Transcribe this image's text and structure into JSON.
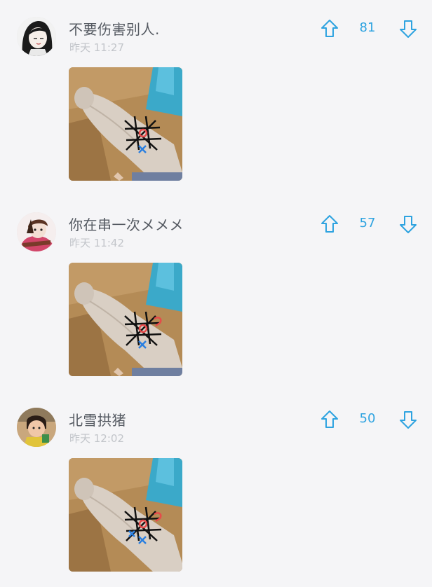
{
  "comments": [
    {
      "username": "不要伤害别人.",
      "timestamp": "昨天 11:27",
      "votes": "81",
      "avatar_icon": "anime-girl-avatar",
      "image_icon": "arm-tic-tac-toe-photo"
    },
    {
      "username": "你在串一次メメメ",
      "timestamp": "昨天 11:42",
      "votes": "57",
      "avatar_icon": "anime-character-avatar",
      "image_icon": "arm-tic-tac-toe-photo"
    },
    {
      "username": "北雪拱猪",
      "timestamp": "昨天 12:02",
      "votes": "50",
      "avatar_icon": "child-photo-avatar",
      "image_icon": "arm-tic-tac-toe-photo"
    }
  ],
  "colors": {
    "accent": "#2ea3e0",
    "username": "#555a62",
    "timestamp": "#c2c5ca",
    "background": "#f5f5f7"
  }
}
